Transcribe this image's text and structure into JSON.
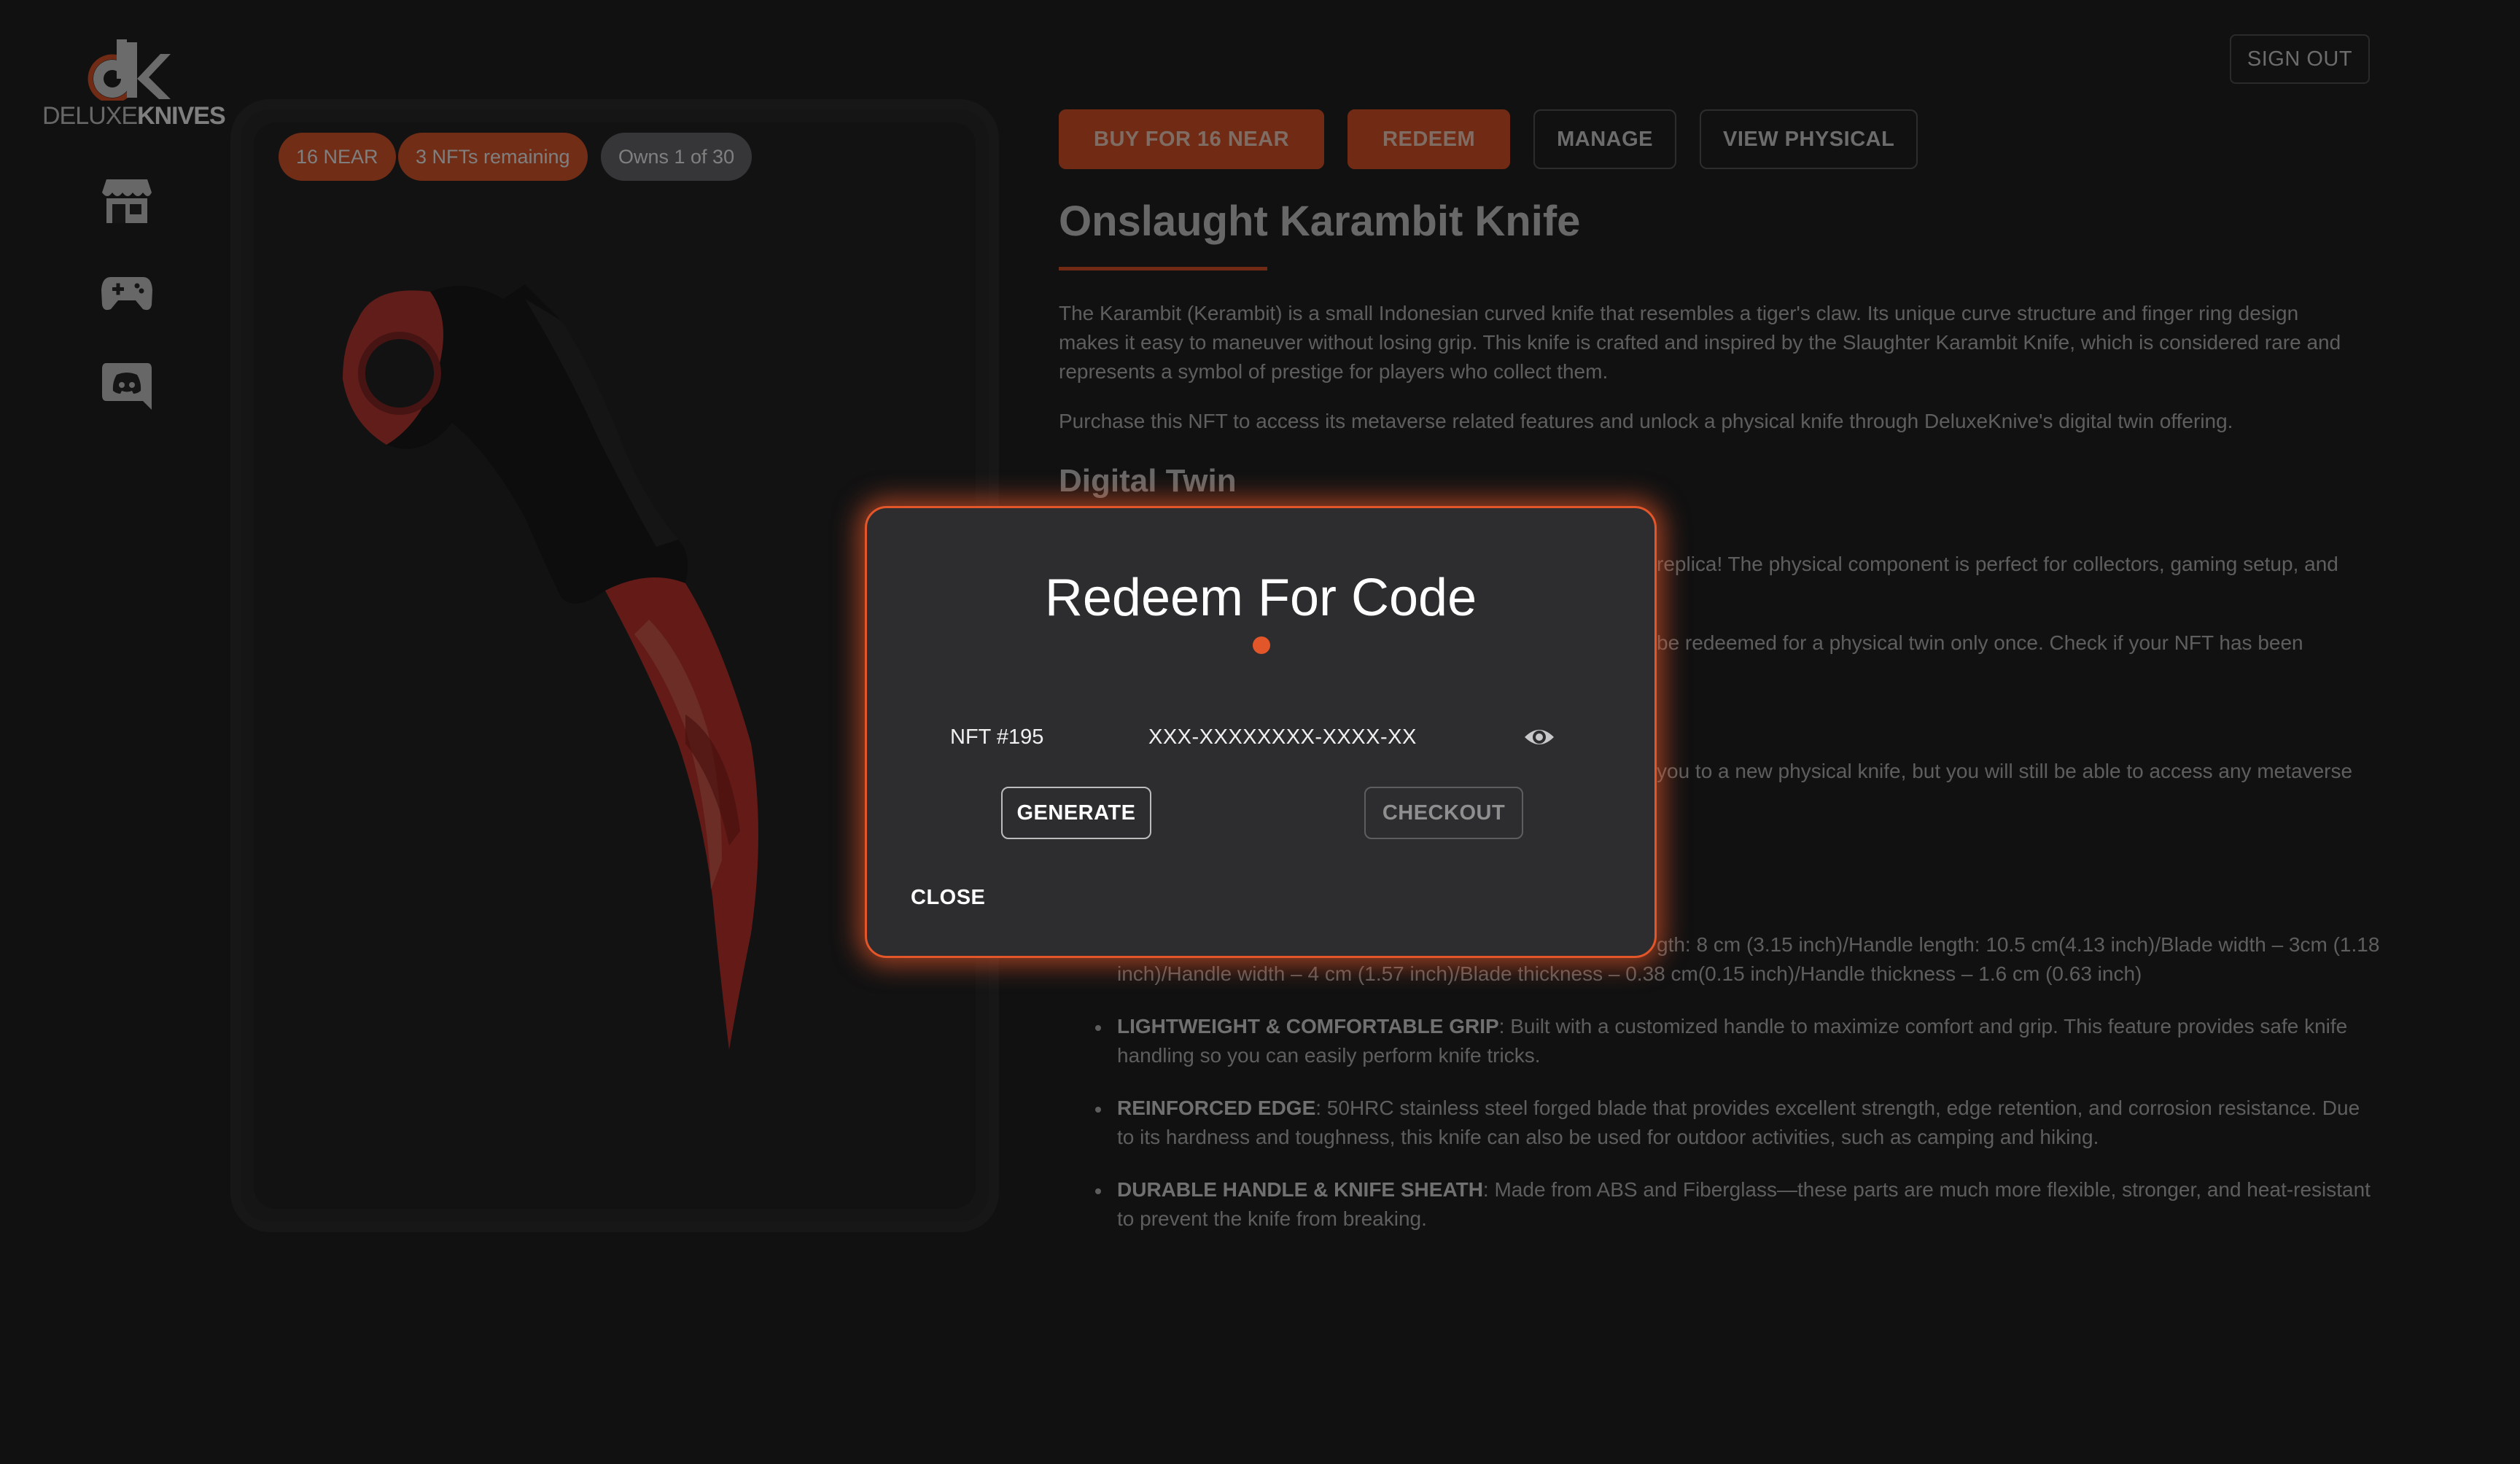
{
  "brand": {
    "logo_prefix": "DELUXE",
    "logo_suffix": "KNIVES"
  },
  "header": {
    "sign_out_label": "SIGN OUT"
  },
  "sidebar": {
    "icons": [
      "store-icon",
      "gamepad-icon",
      "discord-icon"
    ]
  },
  "badges": {
    "price": "16 NEAR",
    "remaining": "3 NFTs remaining",
    "owns": "Owns 1 of 30"
  },
  "actions": {
    "buy": "BUY FOR 16 NEAR",
    "redeem": "REDEEM",
    "manage": "MANAGE",
    "view_physical": "VIEW PHYSICAL"
  },
  "product": {
    "title": "Onslaught Karambit Knife",
    "description_1": "The Karambit (Kerambit) is a small Indonesian curved knife that resembles a tiger's claw. Its unique curve structure and finger ring design makes it easy to maneuver without losing grip. This knife is crafted and inspired by the Slaughter Karambit Knife, which is considered rare and represents a symbol of prestige for players who collect them.",
    "description_2": "Purchase this NFT to access its metaverse related features and unlock a physical knife through DeluxeKnive's digital twin offering.",
    "digital_twin_heading": "Digital Twin",
    "twin_fragment_1": "replica! The physical component is perfect for collectors, gaming setup, and",
    "twin_fragment_2": "be redeemed for a physical twin only once. Check if your NFT has been",
    "twin_fragment_3": "you to a new physical knife, but you will still be able to access any metaverse",
    "specs_fragment_1": "gth: 8 cm (3.15 inch)/Handle length: 10.5 cm(4.13 inch)/Blade width – 3cm (1.18",
    "specs_fragment_2": "inch)/Handle width – 4 cm (1.57 inch)/Blade thickness – 0.38 cm(0.15 inch)/Handle thickness – 1.6 cm (0.63 inch)",
    "features": [
      {
        "name": "LIGHTWEIGHT & COMFORTABLE GRIP",
        "text": ": Built with a customized handle to maximize comfort and grip. This feature provides safe knife handling so you can easily perform knife tricks."
      },
      {
        "name": "REINFORCED EDGE",
        "text": ": 50HRC stainless steel forged blade that provides excellent strength, edge retention, and corrosion resistance. Due to its hardness and toughness, this knife can also be used for outdoor activities, such as camping and hiking."
      },
      {
        "name": "DURABLE HANDLE & KNIFE SHEATH",
        "text": ": Made from ABS and Fiberglass—these parts are much more flexible, stronger, and heat-resistant to prevent the knife from breaking."
      }
    ]
  },
  "modal": {
    "title": "Redeem For Code",
    "nft_label": "NFT #195",
    "code_value": "XXX-XXXXXXXX-XXXX-XX",
    "generate_label": "GENERATE",
    "checkout_label": "CHECKOUT",
    "close_label": "CLOSE"
  },
  "colors": {
    "accent": "#e2562a",
    "background": "#232324",
    "modal": "#2d2d2f"
  }
}
